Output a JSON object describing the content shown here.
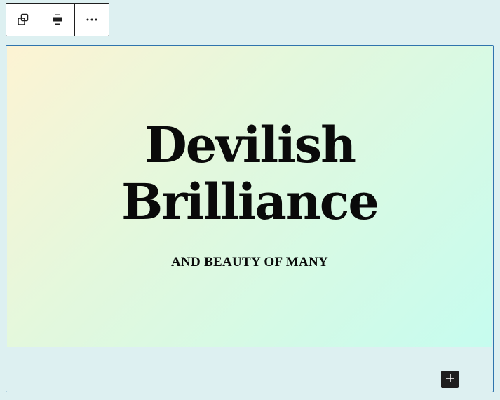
{
  "toolbar": {
    "buttons": [
      {
        "icon": "duplicate-icon"
      },
      {
        "icon": "align-center-icon"
      },
      {
        "icon": "more-options-icon"
      }
    ]
  },
  "cover": {
    "heading_line1": "Devilish",
    "heading_line2": "Brilliance",
    "subheading": "AND BEAUTY OF MANY",
    "gradient": [
      "#fdf3d3",
      "#e3f8dd",
      "#c6fcef"
    ]
  },
  "inserter": {
    "icon": "plus-icon"
  },
  "colors": {
    "canvas": "#ddf0f1",
    "selection_border": "#2f74ad",
    "toolbar_border": "#1e1e1e",
    "text": "#0a0a0a"
  }
}
